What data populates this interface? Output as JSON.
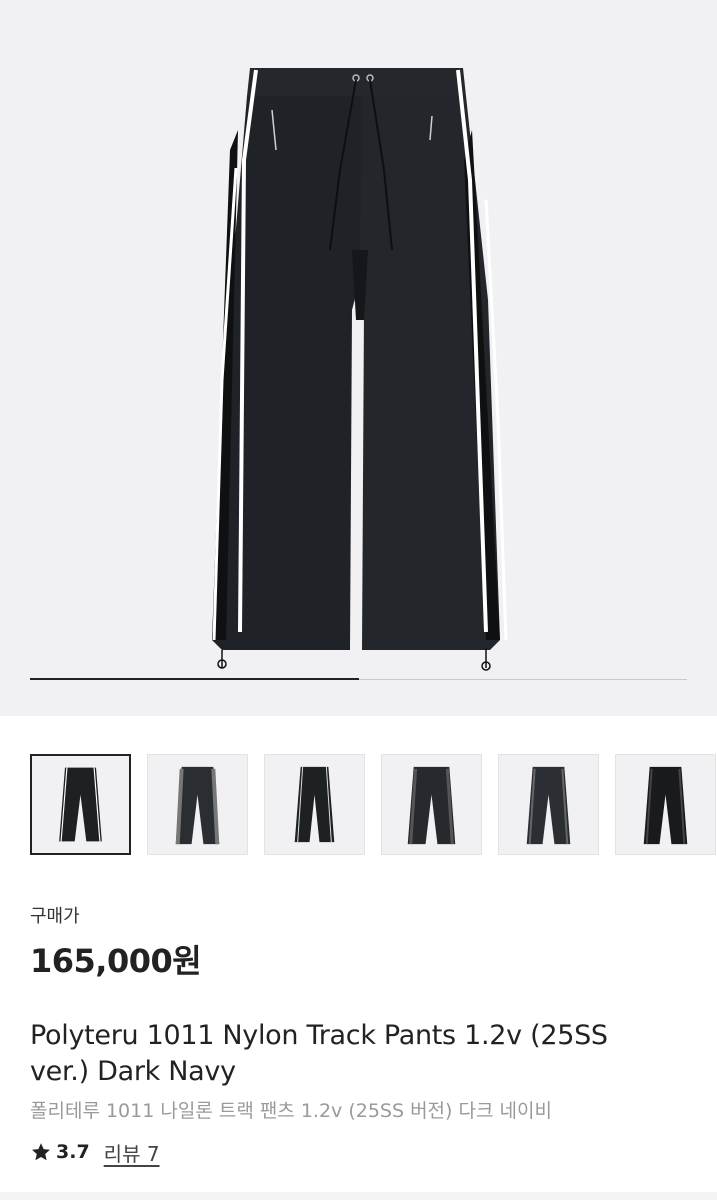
{
  "gallery": {
    "progress_fraction": 0.5,
    "thumbnail_count": 6,
    "selected_index": 0
  },
  "price": {
    "label": "구매가",
    "value": "165,000원"
  },
  "product": {
    "name_en": "Polyteru 1011 Nylon Track Pants 1.2v (25SS ver.) Dark Navy",
    "name_ko": "폴리테루 1011 나일론 트랙 팬츠 1.2v (25SS 버전) 다크 네이비"
  },
  "rating": {
    "icon": "star-icon",
    "value": "3.7",
    "review_label": "리뷰 7"
  },
  "colors": {
    "hero_bg": "#f1f1f3",
    "garment": "#1e2124",
    "stripe": "#ffffff"
  }
}
